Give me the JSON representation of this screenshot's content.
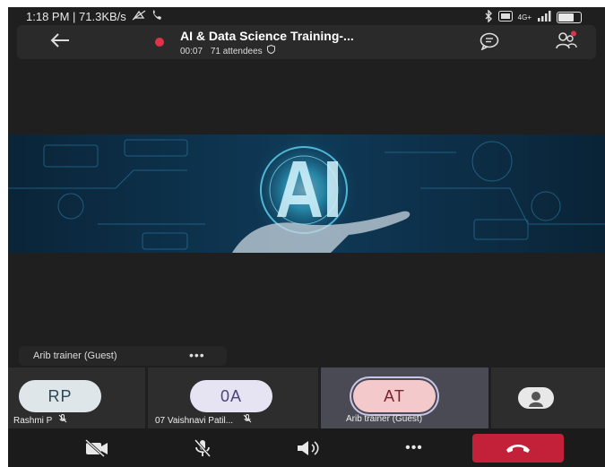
{
  "status_bar": {
    "time_speed": "1:18 PM | 71.3KB/s",
    "network": "4G+"
  },
  "meeting": {
    "title": "AI & Data Science Training-...",
    "duration": "00:07",
    "attendees": "71 attendees"
  },
  "speaker_chip": {
    "name": "Arib trainer (Guest)",
    "more": "•••"
  },
  "participants": [
    {
      "initials": "RP",
      "label": "Rashmi P"
    },
    {
      "initials": "0A",
      "label": "07 Vaishnavi Patil..."
    },
    {
      "initials": "AT",
      "label": "Arib trainer (Guest)"
    }
  ],
  "controls": {
    "more": "•••"
  },
  "colors": {
    "background": "#1f1f1f",
    "record_dot": "#e0334a",
    "hangup": "#c3203a",
    "avatar_rp": "#dfe6ea",
    "avatar_0a": "#e6e3f3",
    "avatar_at": "#f4c9cc"
  }
}
